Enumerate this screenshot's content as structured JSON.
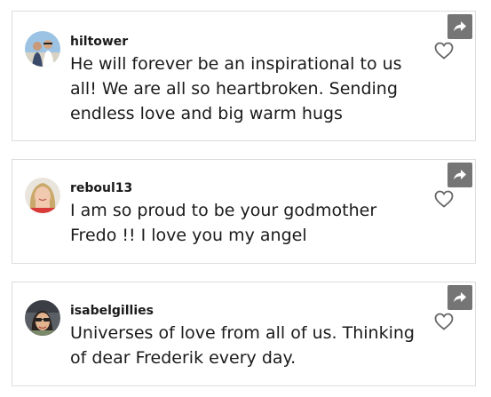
{
  "comments": [
    {
      "username": "hiltower",
      "text": "He will forever be an inspirational to us all! We are all so heartbroken. Sending endless love and big warm hugs"
    },
    {
      "username": "reboul13",
      "text": "I am so proud to be your godmother Fredo !! I love you my angel"
    },
    {
      "username": "isabelgillies",
      "text": "Universes of love from all of us. Thinking of dear Frederik every day."
    }
  ],
  "icons": {
    "share": "share-arrow-icon",
    "like": "heart-outline-icon"
  },
  "colors": {
    "share_button_bg": "#757575",
    "heart_stroke": "#666666",
    "card_border": "#dcdcdc",
    "text": "#1a1a1a"
  }
}
